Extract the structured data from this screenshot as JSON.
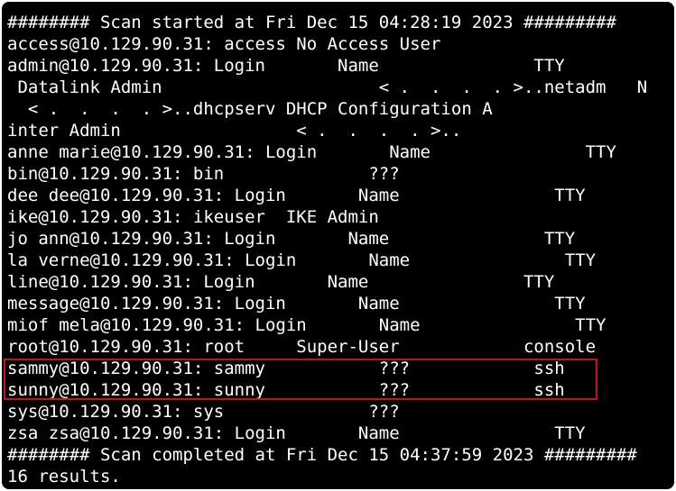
{
  "terminal": {
    "background": "#000000",
    "text_color": "#ffffff",
    "highlight_color": "#c0151e",
    "lines": [
      "######## Scan started at Fri Dec 15 04:28:19 2023 #########",
      "access@10.129.90.31: access No Access User",
      "admin@10.129.90.31: Login       Name               TTY",
      " Datalink Admin                     < .  .  .  . >..netadm   N",
      "  < .  .  .  . >..dhcpserv DHCP Configuration A",
      "inter Admin                 < .  .  .  . >..",
      "anne marie@10.129.90.31: Login       Name               TTY",
      "bin@10.129.90.31: bin              ???",
      "dee dee@10.129.90.31: Login       Name               TTY",
      "ike@10.129.90.31: ikeuser  IKE Admin",
      "jo ann@10.129.90.31: Login       Name               TTY",
      "la verne@10.129.90.31: Login       Name               TTY",
      "line@10.129.90.31: Login       Name               TTY",
      "message@10.129.90.31: Login       Name               TTY",
      "miof mela@10.129.90.31: Login       Name               TTY",
      "root@10.129.90.31: root     Super-User            console",
      "sammy@10.129.90.31: sammy           ???            ssh",
      "sunny@10.129.90.31: sunny           ???            ssh",
      "sys@10.129.90.31: sys              ???",
      "zsa zsa@10.129.90.31: Login       Name               TTY",
      "######## Scan completed at Fri Dec 15 04:37:59 2023 #########",
      "16 results."
    ]
  }
}
